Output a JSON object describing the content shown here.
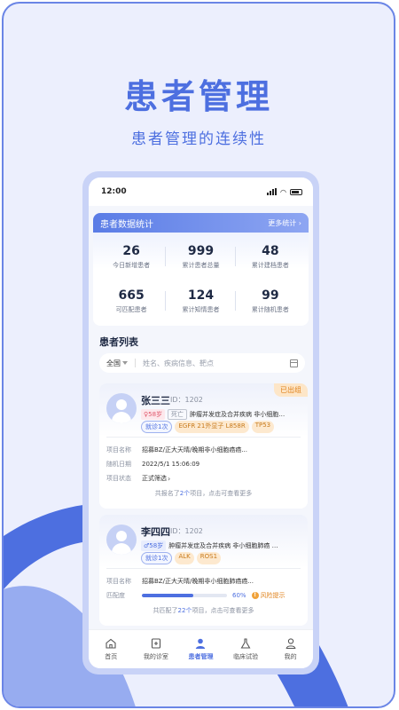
{
  "hero": {
    "title": "患者管理",
    "subtitle": "患者管理的连续性"
  },
  "status_bar": {
    "time": "12:00"
  },
  "stats": {
    "title": "患者数据统计",
    "more": "更多统计 ›",
    "items": [
      {
        "value": "26",
        "label": "今日新增患者"
      },
      {
        "value": "999",
        "label": "累计患者总量"
      },
      {
        "value": "48",
        "label": "累计建档患者"
      },
      {
        "value": "665",
        "label": "可匹配患者"
      },
      {
        "value": "124",
        "label": "累计知情患者"
      },
      {
        "value": "99",
        "label": "累计随机患者"
      }
    ]
  },
  "patient_list": {
    "title": "患者列表",
    "filter": {
      "region": "全国",
      "placeholder": "姓名、疾病信息、靶点"
    }
  },
  "patients": [
    {
      "name": "张三三",
      "id": "ID：1202",
      "status_badge": "已出组",
      "age": "♀58岁",
      "deceased": "死亡",
      "diagnosis": "肿瘤并发症及合并疾病 非小细胞…",
      "visit": "就诊1次",
      "genes": [
        "EGFR 21外显子 L858R",
        "TP53"
      ],
      "fields": [
        {
          "key": "项目名称",
          "value": "招募BZ/正大天晴/晚期非小细胞癌癌..."
        },
        {
          "key": "随机日期",
          "value": "2022/5/1 15:06:09"
        },
        {
          "key": "项目状态",
          "value": "正式筛选"
        }
      ],
      "footer_pre": "共报名了",
      "footer_count": "2个",
      "footer_post": "项目，点击可查看更多"
    },
    {
      "name": "李四四",
      "id": "ID：1202",
      "age": "♂58岁",
      "diagnosis": "肿瘤并发症及合并疾病 非小细胞肺癌 …",
      "visit": "就诊1次",
      "genes": [
        "ALK",
        "ROS1"
      ],
      "fields": [
        {
          "key": "项目名称",
          "value": "招募BZ/正大天晴/晚期非小细胞肺癌癌..."
        }
      ],
      "match_label": "匹配度",
      "match_value": 0.6,
      "match_pct": "60%",
      "match_warning": "风险提示",
      "footer_pre": "共匹配了",
      "footer_count": "22个",
      "footer_post": "项目，点击可查看更多"
    }
  ],
  "tabbar": {
    "items": [
      {
        "label": "首页",
        "icon": "home-icon"
      },
      {
        "label": "我的诊室",
        "icon": "clinic-icon"
      },
      {
        "label": "患者管理",
        "icon": "patient-icon",
        "active": true
      },
      {
        "label": "临床试验",
        "icon": "flask-icon"
      },
      {
        "label": "我的",
        "icon": "profile-icon"
      }
    ]
  },
  "colors": {
    "accent": "#4d6fe0",
    "background": "#eceffd",
    "warning": "#e0821b"
  }
}
